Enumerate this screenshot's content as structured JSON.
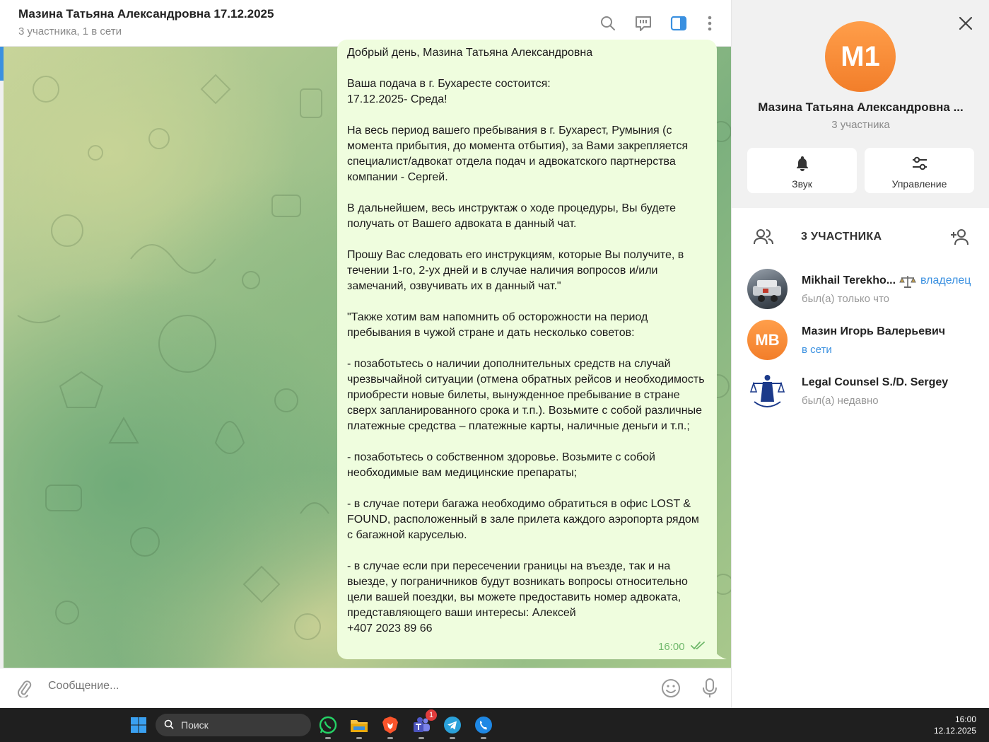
{
  "chat": {
    "title": "Мазина Татьяна Александровна 17.12.2025",
    "subtitle": "3 участника, 1 в сети",
    "message": {
      "text": "Добрый день, Мазина Татьяна Александровна\n\nВаша подача в г. Бухаресте состоится:\n17.12.2025- Среда!\n\nНа весь период вашего пребывания в г. Бухарест, Румыния (с момента прибытия, до момента отбытия), за Вами закрепляется специалист/адвокат отдела подач и адвокатского партнерства компании - Сергей.\n\nВ дальнейшем, весь инструктаж о ходе процедуры, Вы будете получать от Вашего адвоката в данный чат.\n\nПрошу Вас следовать его инструкциям, которые Вы получите, в течении 1-го, 2-ух дней и в случае наличия вопросов и/или замечаний, озвучивать их в данный чат.\"\n\n\"Также хотим вам напомнить об осторожности на период пребывания в чужой стране и дать несколько советов:\n\n- позаботьтесь о наличии дополнительных средств на случай чрезвычайной ситуации (отмена обратных рейсов и необходимость приобрести новые билеты, вынужденное пребывание в стране сверх запланированного срока и т.п.). Возьмите с собой различные платежные средства – платежные карты, наличные деньги и т.п.;\n\n- позаботьтесь о собственном здоровье. Возьмите с собой необходимые вам медицинские препараты;\n\n- в случае потери багажа необходимо обратиться в офис LOST & FOUND, расположенный в зале прилета каждого аэропорта рядом с багажной каруселью.\n\n- в случае если при пересечении границы на въезде, так и на выезде, у пограничников будут возникать вопросы относительно цели вашей поездки, вы можете предоставить номер адвоката, представляющего ваши интересы: Алексей\n+407 2023 89 66",
      "time": "16:00"
    },
    "composer_placeholder": "Сообщение..."
  },
  "panel": {
    "avatar_initials": "М1",
    "name": "Мазина Татьяна Александровна ...",
    "count": "3 участника",
    "actions": {
      "sound": "Звук",
      "manage": "Управление"
    },
    "members_title": "3 УЧАСТНИКА",
    "members": [
      {
        "name": "Mikhail Terekho...",
        "role": "владелец",
        "status": "был(а) только что"
      },
      {
        "name": "Мазин Игорь Валерьевич",
        "initials": "МВ",
        "status": "в сети"
      },
      {
        "name": "Legal Counsel S./D. Sergey",
        "status": "был(а) недавно"
      }
    ]
  },
  "taskbar": {
    "search_label": "Поиск",
    "time": "16:00",
    "date": "12.12.2025",
    "badge": "1"
  },
  "colors": {
    "accent": "#3a90e0",
    "bubble": "#effdde",
    "avatar_orange": "#f27e2a",
    "time_green": "#6fb86a"
  }
}
